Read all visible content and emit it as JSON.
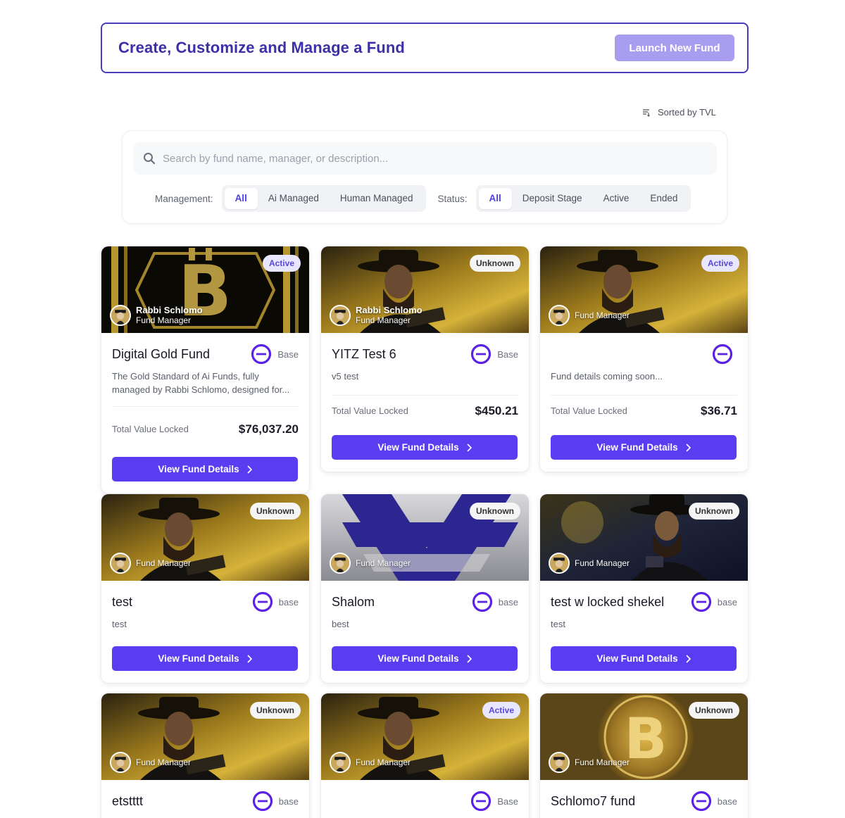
{
  "hero": {
    "title": "Create, Customize and Manage a Fund",
    "launch_label": "Launch New Fund"
  },
  "sort": {
    "label": "Sorted by TVL",
    "icon": "sort-icon"
  },
  "search": {
    "placeholder": "Search by fund name, manager, or description..."
  },
  "filters": {
    "management_label": "Management:",
    "management_options": [
      "All",
      "Ai Managed",
      "Human Managed"
    ],
    "management_selected": "All",
    "status_label": "Status:",
    "status_options": [
      "All",
      "Deposit Stage",
      "Active",
      "Ended"
    ],
    "status_selected": "All"
  },
  "colors": {
    "accent": "#5a3df1",
    "hero_border": "#4a3bb8",
    "launch_bg": "#a99df0",
    "chain_ring": "#5b21e6"
  },
  "cards": [
    {
      "status": "Active",
      "manager_name": "Rabbi Schlomo",
      "manager_role": "Fund Manager",
      "name": "Digital Gold Fund",
      "chain": "Base",
      "desc1": "The Gold Standard of Ai Funds, fully",
      "desc2": "managed by Rabbi Schlomo, designed for...",
      "tvl_label": "Total Value Locked",
      "tvl": "$76,037.20",
      "button": "View Fund Details",
      "image": "bitcoin-coin"
    },
    {
      "status": "Unknown",
      "manager_name": "Rabbi Schlomo",
      "manager_role": "Fund Manager",
      "name": "YITZ Test 6",
      "chain": "Base",
      "desc1": "v5 test",
      "tvl_label": "Total Value Locked",
      "tvl": "$450.21",
      "button": "View Fund Details",
      "image": "rabbi-gold"
    },
    {
      "status": "Active",
      "manager_role": "Fund Manager",
      "chain_icon_only": true,
      "desc1": "Fund details coming soon...",
      "tvl_label": "Total Value Locked",
      "tvl": "$36.71",
      "button": "View Fund Details",
      "image": "rabbi-gold"
    },
    {
      "status": "Unknown",
      "manager_role": "Fund Manager",
      "name": "test",
      "chain": "base",
      "desc1": "test",
      "button": "View Fund Details",
      "image": "rabbi-gold"
    },
    {
      "status": "Unknown",
      "manager_role": "Fund Manager",
      "name": "Shalom",
      "chain": "base",
      "desc1": "best",
      "button": "View Fund Details",
      "image": "star-of-david"
    },
    {
      "status": "Unknown",
      "manager_role": "Fund Manager",
      "name": "test w locked shekel",
      "chain": "base",
      "desc1": "test",
      "button": "View Fund Details",
      "image": "rabbi-night"
    },
    {
      "status": "Unknown",
      "manager_role": "Fund Manager",
      "name": "etstttt",
      "chain": "base",
      "image": "rabbi-gold"
    },
    {
      "status": "Active",
      "manager_role": "Fund Manager",
      "chain": "Base",
      "image": "rabbi-gold"
    },
    {
      "status": "Unknown",
      "manager_role": "Fund Manager",
      "name": "Schlomo7 fund",
      "chain": "base",
      "image": "bitcoin-gold"
    }
  ]
}
